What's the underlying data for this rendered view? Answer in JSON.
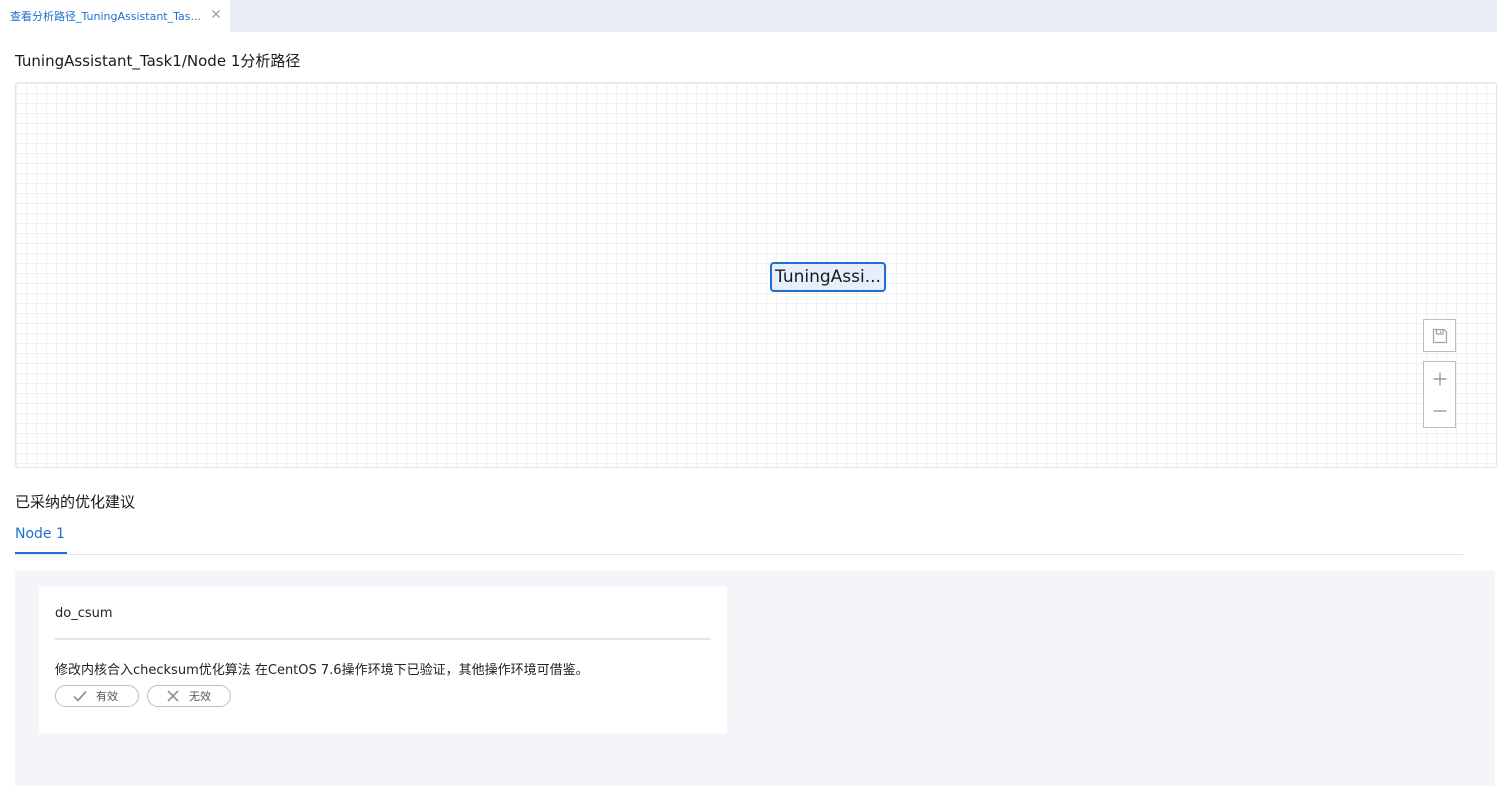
{
  "tab": {
    "label": "查看分析路径_TuningAssistant_Tas...",
    "close_icon": "close-icon"
  },
  "page": {
    "title": "TuningAssistant_Task1/Node 1分析路径"
  },
  "canvas": {
    "node_label": "TuningAssi...",
    "controls": [
      "save-icon",
      "zoom-in-icon",
      "zoom-out-icon"
    ]
  },
  "suggestions": {
    "title": "已采纳的优化建议",
    "tabs": [
      {
        "label": "Node 1",
        "active": true
      }
    ],
    "cards": [
      {
        "title": "do_csum",
        "description": "修改内核合入checksum优化算法 在CentOS 7.6操作环境下已验证，其他操作环境可借鉴。",
        "valid_label": "有效",
        "invalid_label": "无效"
      }
    ]
  },
  "colors": {
    "accent": "#1e6fd1",
    "tabbar_bg": "#e9eef6",
    "panel_bg": "#f4f5f9",
    "node_fill": "#e6effb"
  }
}
